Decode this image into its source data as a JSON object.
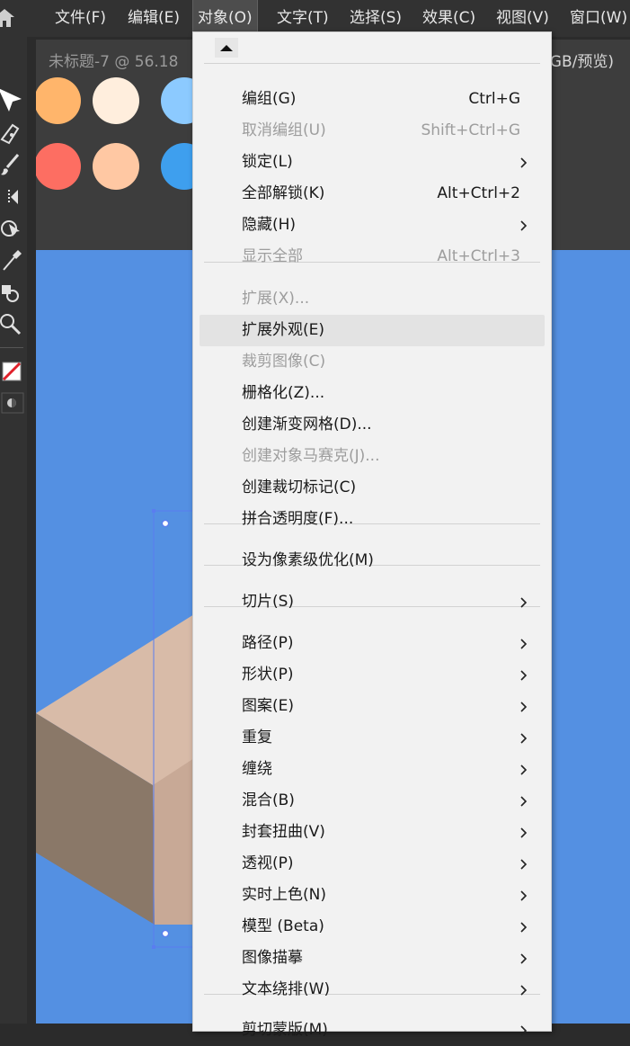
{
  "menubar": {
    "items": [
      {
        "label": "文件(F)"
      },
      {
        "label": "编辑(E)"
      },
      {
        "label": "对象(O)",
        "active": true
      },
      {
        "label": "文字(T)"
      },
      {
        "label": "选择(S)"
      },
      {
        "label": "效果(C)"
      },
      {
        "label": "视图(V)"
      },
      {
        "label": "窗口(W)"
      }
    ]
  },
  "document": {
    "tab_title": "未标题-7 @ 56.18",
    "mode": "GB/预览)"
  },
  "swatch_colors": [
    "#ffb56b",
    "#ffeedd",
    "#8ccaff",
    "#fd6e62",
    "#ffc8a3",
    "#3e9fee"
  ],
  "canvas": {
    "background": "#5490e2",
    "box_top": "#d8bba8",
    "box_left": "#8a7868",
    "box_right": "#c8a996",
    "selection": "#5a7df0"
  },
  "menu": {
    "items": [
      {
        "label": "编组(G)",
        "shortcut": "Ctrl+G",
        "enabled": true
      },
      {
        "label": "取消编组(U)",
        "shortcut": "Shift+Ctrl+G",
        "enabled": false
      },
      {
        "label": "锁定(L)",
        "submenu": true,
        "enabled": true
      },
      {
        "label": "全部解锁(K)",
        "shortcut": "Alt+Ctrl+2",
        "enabled": true
      },
      {
        "label": "隐藏(H)",
        "submenu": true,
        "enabled": true
      },
      {
        "label": "显示全部",
        "shortcut": "Alt+Ctrl+3",
        "enabled": false
      },
      {
        "label": "扩展(X)...",
        "enabled": false
      },
      {
        "label": "扩展外观(E)",
        "enabled": true,
        "hovered": true
      },
      {
        "label": "裁剪图像(C)",
        "enabled": false
      },
      {
        "label": "栅格化(Z)...",
        "enabled": true
      },
      {
        "label": "创建渐变网格(D)...",
        "enabled": true
      },
      {
        "label": "创建对象马赛克(J)...",
        "enabled": false
      },
      {
        "label": "创建裁切标记(C)",
        "enabled": true
      },
      {
        "label": "拼合透明度(F)...",
        "enabled": true
      },
      {
        "label": "设为像素级优化(M)",
        "enabled": true
      },
      {
        "label": "切片(S)",
        "submenu": true,
        "enabled": true
      },
      {
        "label": "路径(P)",
        "submenu": true,
        "enabled": true
      },
      {
        "label": "形状(P)",
        "submenu": true,
        "enabled": true
      },
      {
        "label": "图案(E)",
        "submenu": true,
        "enabled": true
      },
      {
        "label": "重复",
        "submenu": true,
        "enabled": true
      },
      {
        "label": "缠绕",
        "submenu": true,
        "enabled": true
      },
      {
        "label": "混合(B)",
        "submenu": true,
        "enabled": true
      },
      {
        "label": "封套扭曲(V)",
        "submenu": true,
        "enabled": true
      },
      {
        "label": "透视(P)",
        "submenu": true,
        "enabled": true
      },
      {
        "label": "实时上色(N)",
        "submenu": true,
        "enabled": true
      },
      {
        "label": "模型 (Beta)",
        "submenu": true,
        "enabled": true
      },
      {
        "label": "图像描摹",
        "submenu": true,
        "enabled": true
      },
      {
        "label": "文本绕排(W)",
        "submenu": true,
        "enabled": true
      },
      {
        "label": "剪切蒙版(M)",
        "submenu": true,
        "enabled": true
      }
    ]
  }
}
